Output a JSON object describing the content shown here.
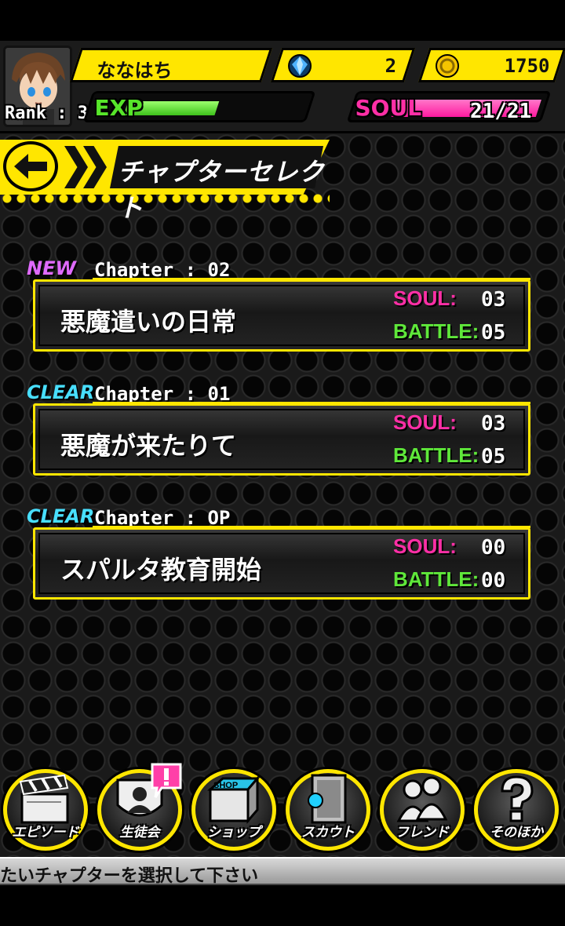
{
  "player": {
    "name": "ななはち",
    "rank_label": "Rank : 3",
    "gems": "2",
    "coins": "1750",
    "exp_label": "EXP",
    "exp_progress": 0.5,
    "soul_label": "SOUL",
    "soul_value": "21/21",
    "soul_progress": 1.0
  },
  "header": {
    "title": "チャプターセレクト"
  },
  "chapters": [
    {
      "status": "NEW",
      "label": "Chapter : 02",
      "title": "悪魔遣いの日常",
      "soul_label": "SOUL:",
      "soul": "03",
      "battle_label": "BATTLE:",
      "battle": "05"
    },
    {
      "status": "CLEAR",
      "label": "Chapter : 01",
      "title": "悪魔が来たりて",
      "soul_label": "SOUL:",
      "soul": "03",
      "battle_label": "BATTLE:",
      "battle": "05"
    },
    {
      "status": "CLEAR",
      "label": "Chapter : OP",
      "title": "スパルタ教育開始",
      "soul_label": "SOUL:",
      "soul": "00",
      "battle_label": "BATTLE:",
      "battle": "00"
    }
  ],
  "menu": [
    {
      "label": "エピソード",
      "icon": "clapperboard-icon"
    },
    {
      "label": "生徒会",
      "icon": "student-council-icon"
    },
    {
      "label": "ショップ",
      "icon": "shop-icon"
    },
    {
      "label": "スカウト",
      "icon": "scout-door-icon"
    },
    {
      "label": "フレンド",
      "icon": "friend-icon"
    },
    {
      "label": "そのほか",
      "icon": "question-icon"
    }
  ],
  "ticker": {
    "text": "たいチャプターを選択して下さい"
  },
  "colors": {
    "accent": "#ffe600",
    "soul": "#ff2fa6",
    "exp": "#57e52a",
    "clear": "#48dfff",
    "new": "#e06aff"
  }
}
